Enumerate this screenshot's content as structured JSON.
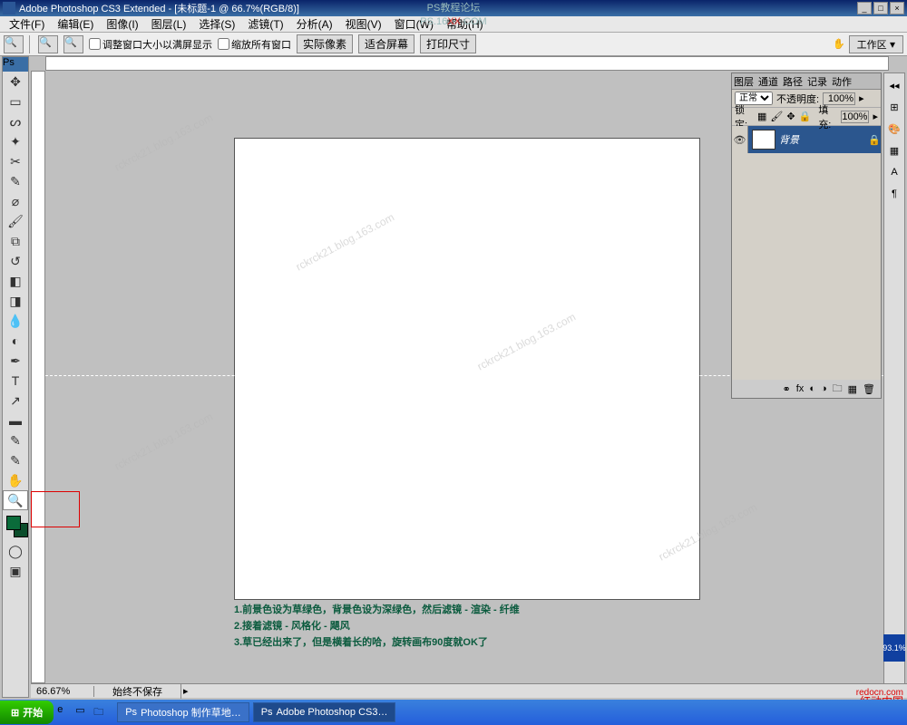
{
  "title": "Adobe Photoshop CS3 Extended - [未标题-1 @ 66.7%(RGB/8)]",
  "overlay_title": "PS教程论坛",
  "overlay_sub": "PS.16XX.COM",
  "menu": {
    "file": "文件(F)",
    "edit": "编辑(E)",
    "image": "图像(I)",
    "layer": "图层(L)",
    "select": "选择(S)",
    "filter": "滤镜(T)",
    "analysis": "分析(A)",
    "view": "视图(V)",
    "window": "窗口(W)",
    "help": "帮助(H)"
  },
  "options": {
    "fit_window": "调整窗口大小以满屏显示",
    "zoom_all": "缩放所有窗口",
    "actual": "实际像素",
    "fit_screen": "适合屏幕",
    "print_size": "打印尺寸",
    "workspace": "工作区"
  },
  "panel": {
    "tab_layer": "图层",
    "tab_channel": "通道",
    "tab_path": "路径",
    "tab_history": "记录",
    "tab_action": "动作",
    "blend": "正常",
    "opacity_lbl": "不透明度:",
    "opacity_val": "100%",
    "lock_lbl": "锁定:",
    "fill_lbl": "填充:",
    "fill_val": "100%",
    "layer_name": "背景"
  },
  "status": {
    "zoom": "66.67%",
    "doc": "始终不保存"
  },
  "nav_percent": "93.1%",
  "instructions": {
    "l1": "1.前景色设为草绿色，背景色设为深绿色，然后滤镜 - 渲染 - 纤维",
    "l2": "2.接着滤镜 - 风格化 - 飓风",
    "l3": "3.草已经出来了，但是横着长的哈，旋转画布90度就OK了"
  },
  "taskbar": {
    "start": "开始",
    "t1": "Photoshop 制作草地…",
    "t2": "Adobe Photoshop CS3…"
  },
  "watermark": "rckrck21.blog.163.com",
  "credit1": "redocn.com",
  "credit2": "红动中国"
}
